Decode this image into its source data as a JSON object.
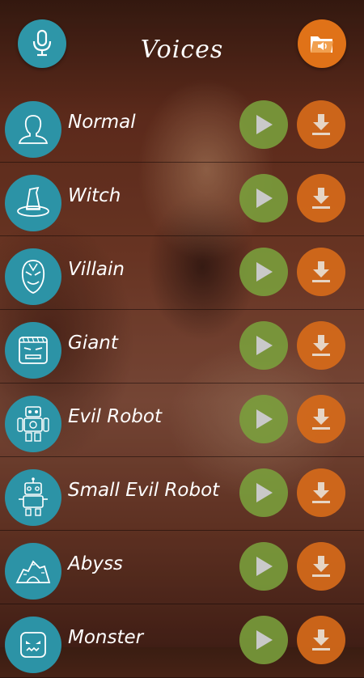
{
  "header": {
    "title": "Voices",
    "left_icon": "microphone-icon",
    "right_icon": "sound-folder-icon"
  },
  "colors": {
    "accent_teal": "#2c93a6",
    "play_green": "#7aa03c",
    "download_orange": "#d66a1a"
  },
  "voices": [
    {
      "label": "Normal",
      "icon": "person-icon"
    },
    {
      "label": "Witch",
      "icon": "witch-hat-icon"
    },
    {
      "label": "Villain",
      "icon": "villain-face-icon"
    },
    {
      "label": "Giant",
      "icon": "giant-face-icon"
    },
    {
      "label": "Evil Robot",
      "icon": "evil-robot-icon"
    },
    {
      "label": "Small Evil Robot",
      "icon": "small-robot-icon"
    },
    {
      "label": "Abyss",
      "icon": "cave-icon"
    },
    {
      "label": "Monster",
      "icon": "monster-icon"
    }
  ]
}
